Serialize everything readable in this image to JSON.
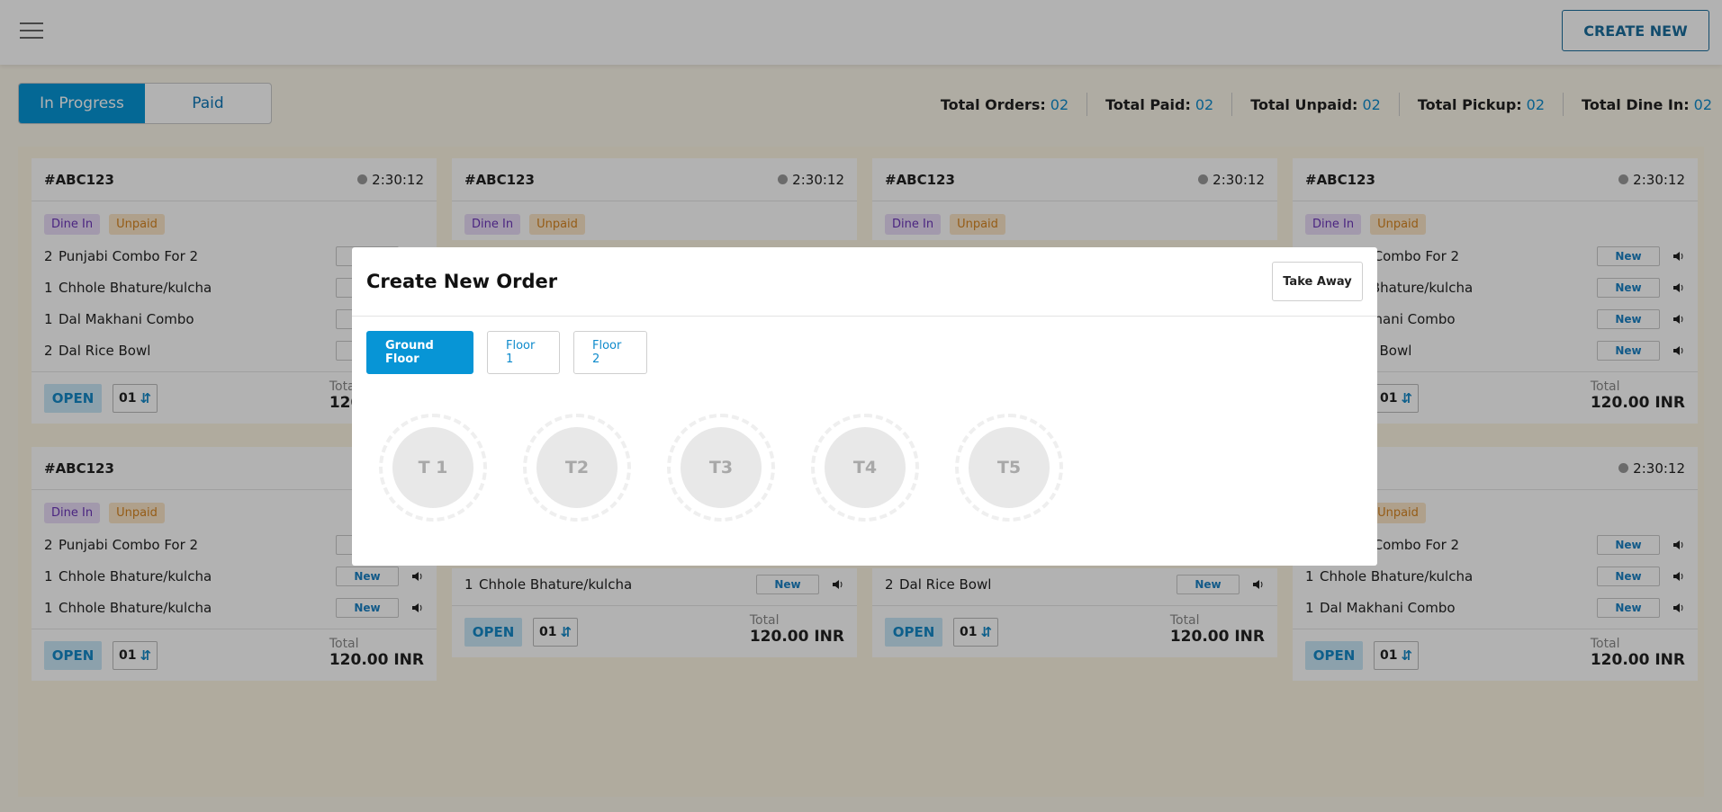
{
  "header": {
    "create_new_label": "CREATE NEW"
  },
  "tabs": {
    "in_progress": "In Progress",
    "paid": "Paid"
  },
  "stats": [
    {
      "label": "Total Orders:",
      "value": "02"
    },
    {
      "label": "Total Paid:",
      "value": "02"
    },
    {
      "label": "Total Unpaid:",
      "value": "02"
    },
    {
      "label": "Total Pickup:",
      "value": "02"
    },
    {
      "label": "Total Dine In:",
      "value": "02"
    }
  ],
  "common": {
    "new_label": "New",
    "open_label": "OPEN",
    "qty_label": "01",
    "total_label": "Total",
    "total_value": "120.00 INR",
    "dine_in": "Dine In",
    "unpaid": "Unpaid",
    "order_id": "#ABC123",
    "time": "2:30:12"
  },
  "items": {
    "punjabi": {
      "qty": "2",
      "name": "Punjabi Combo For 2"
    },
    "chhole": {
      "qty": "1",
      "name": "Chhole Bhature/kulcha"
    },
    "dal_makhani": {
      "qty": "1",
      "name": "Dal Makhani Combo"
    },
    "dal_rice": {
      "qty": "2",
      "name": "Dal Rice Bowl"
    }
  },
  "modal": {
    "title": "Create New Order",
    "take_away_label": "Take Away",
    "floors": [
      "Ground Floor",
      "Floor 1",
      "Floor 2"
    ],
    "tables": [
      "T 1",
      "T2",
      "T3",
      "T4",
      "T5"
    ]
  }
}
